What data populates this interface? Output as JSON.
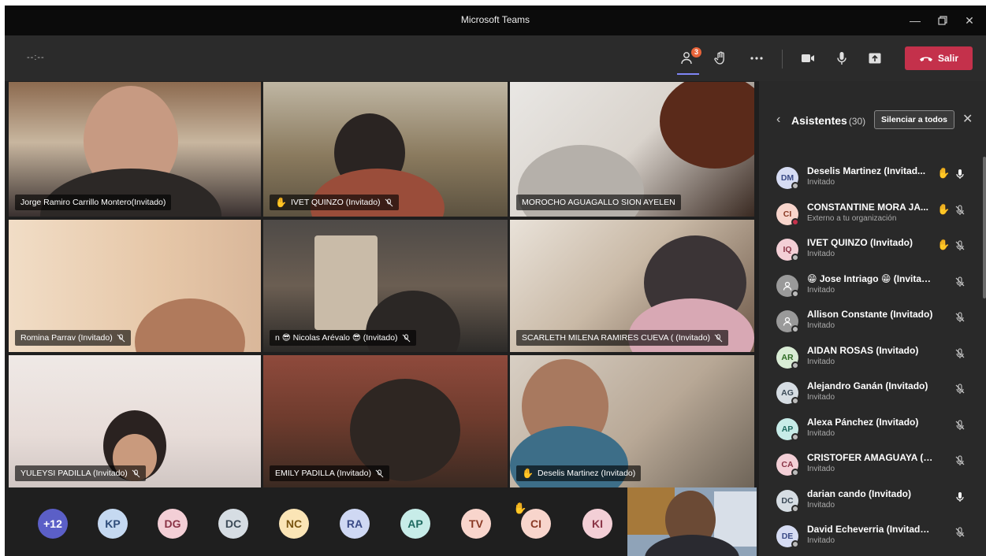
{
  "window": {
    "title": "Microsoft Teams"
  },
  "toolbar": {
    "timer": "--:--",
    "people_badge": "3",
    "leave_label": "Salir"
  },
  "tiles": [
    {
      "name": "Jorge Ramiro Carrillo Montero(Invitado)",
      "muted": false,
      "hand": false
    },
    {
      "name": "IVET QUINZO (Invitado)",
      "muted": true,
      "hand": true
    },
    {
      "name": "MOROCHO AGUAGALLO SION AYELEN",
      "muted": false,
      "hand": false
    },
    {
      "name": "Romina Parrav (Invitado)",
      "muted": true,
      "hand": false
    },
    {
      "name": "n 😎 Nicolas Arévalo 😎 (Invitado)",
      "muted": true,
      "hand": false
    },
    {
      "name": "SCARLETH MILENA RAMIRES CUEVA ( (Invitado)",
      "muted": true,
      "hand": false
    },
    {
      "name": "YULEYSI PADILLA (Invitado)",
      "muted": true,
      "hand": false
    },
    {
      "name": "EMILY PADILLA (Invitado)",
      "muted": true,
      "hand": false
    },
    {
      "name": "Deselis Martinez (Invitado)",
      "muted": false,
      "hand": true
    }
  ],
  "strip": [
    {
      "initials": "+12",
      "bg": "#5b5fc7",
      "fg": "#ffffff"
    },
    {
      "initials": "KP",
      "bg": "#c5d9f1",
      "fg": "#2f4d7a"
    },
    {
      "initials": "DG",
      "bg": "#f3cfd6",
      "fg": "#8a3446"
    },
    {
      "initials": "DC",
      "bg": "#d6dde3",
      "fg": "#3b4a57"
    },
    {
      "initials": "NC",
      "bg": "#fbe5b6",
      "fg": "#7a5510"
    },
    {
      "initials": "RA",
      "bg": "#cfd8f3",
      "fg": "#3a4a86"
    },
    {
      "initials": "AP",
      "bg": "#c7ece8",
      "fg": "#1f6a60"
    },
    {
      "initials": "TV",
      "bg": "#f8d5cc",
      "fg": "#8a3a25"
    },
    {
      "initials": "CI",
      "bg": "#f8d5cc",
      "fg": "#8a3a25"
    },
    {
      "initials": "KI",
      "bg": "#f3cfd6",
      "fg": "#8a3446"
    }
  ],
  "panel": {
    "title": "Asistentes",
    "count": "(30)",
    "mute_all_label": "Silenciar a todos",
    "participants": [
      {
        "initials": "DM",
        "name": "Deselis Martinez (Invitad...",
        "role": "Invitado",
        "hand": true,
        "mic": "on",
        "bg": "#d6dcf3",
        "fg": "#3a4a86",
        "status": "#bbbbbb"
      },
      {
        "initials": "CI",
        "name": "CONSTANTINE MORA JA...",
        "role": "Externo a tu organización",
        "hand": true,
        "mic": "off",
        "bg": "#f8d5cc",
        "fg": "#8a3a25",
        "status": "#c4314b"
      },
      {
        "initials": "IQ",
        "name": "IVET QUINZO (Invitado)",
        "role": "Invitado",
        "hand": true,
        "mic": "off",
        "bg": "#f3cfd6",
        "fg": "#8a3446",
        "status": "#bbbbbb"
      },
      {
        "initials": "",
        "name": "😁 Jose Intriago 😁 (Invitado)",
        "role": "Invitado",
        "hand": false,
        "mic": "off",
        "bg": "#9a9a9a",
        "fg": "#ffffff",
        "status": "#bbbbbb"
      },
      {
        "initials": "",
        "name": "Allison Constante (Invitado)",
        "role": "Invitado",
        "hand": false,
        "mic": "off",
        "bg": "#9a9a9a",
        "fg": "#ffffff",
        "status": "#bbbbbb"
      },
      {
        "initials": "AR",
        "name": "AIDAN ROSAS (Invitado)",
        "role": "Invitado",
        "hand": false,
        "mic": "off",
        "bg": "#d9ecd5",
        "fg": "#2f6b25",
        "status": "#bbbbbb"
      },
      {
        "initials": "AG",
        "name": "Alejandro Ganán (Invitado)",
        "role": "Invitado",
        "hand": false,
        "mic": "off",
        "bg": "#d6dde3",
        "fg": "#3b4a57",
        "status": "#bbbbbb"
      },
      {
        "initials": "AP",
        "name": "Alexa Pánchez (Invitado)",
        "role": "Invitado",
        "hand": false,
        "mic": "off",
        "bg": "#c7ece8",
        "fg": "#1f6a60",
        "status": "#bbbbbb"
      },
      {
        "initials": "CA",
        "name": "CRISTOFER AMAGUAYA (Invit...",
        "role": "Invitado",
        "hand": false,
        "mic": "off",
        "bg": "#f3cfd6",
        "fg": "#8a3446",
        "status": "#bbbbbb"
      },
      {
        "initials": "DC",
        "name": "darian cando (Invitado)",
        "role": "Invitado",
        "hand": false,
        "mic": "on",
        "bg": "#d6dde3",
        "fg": "#3b4a57",
        "status": "#bbbbbb"
      },
      {
        "initials": "DE",
        "name": "David Echeverria (Invitado (In...",
        "role": "Invitado",
        "hand": false,
        "mic": "off",
        "bg": "#d6dcf3",
        "fg": "#3a4a86",
        "status": "#bbbbbb"
      }
    ]
  }
}
